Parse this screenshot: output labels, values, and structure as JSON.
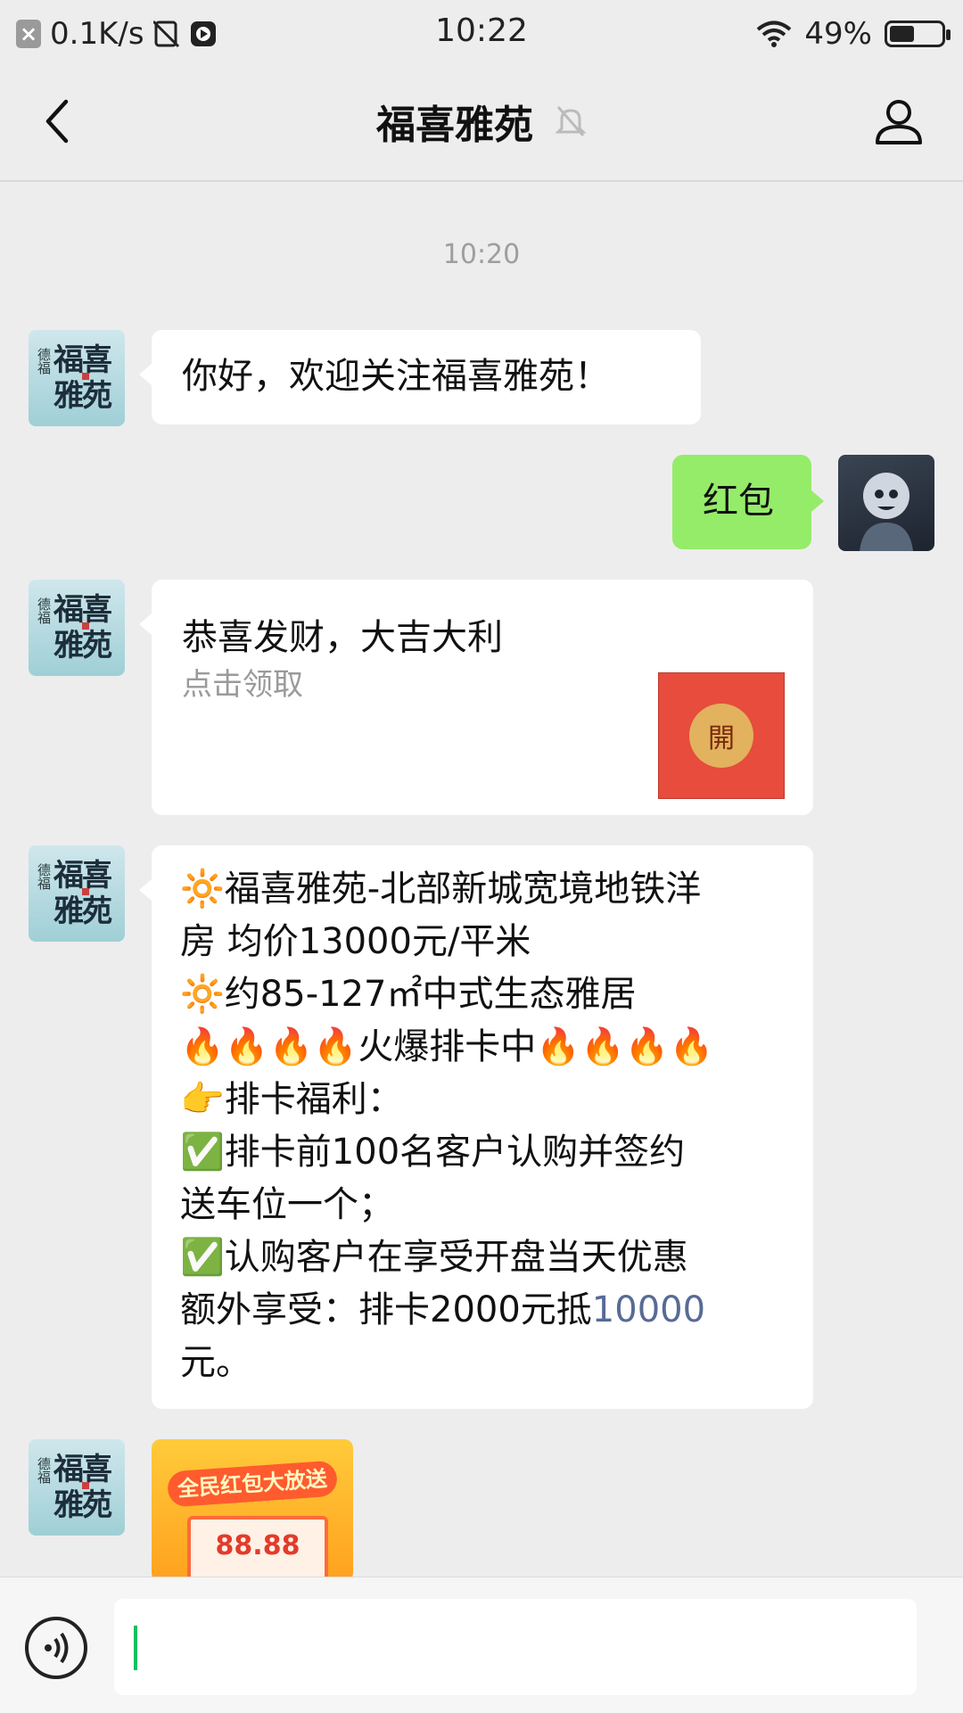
{
  "status_bar": {
    "net_speed": "0.1K/s",
    "time": "10:22",
    "battery": "49%",
    "battery_level": 0.49,
    "icons": [
      "close-app-icon",
      "no-sim-icon",
      "media-play-icon",
      "wifi-icon",
      "battery-icon"
    ]
  },
  "header": {
    "title": "福喜雅苑",
    "icons": [
      "back-arrow-icon",
      "mute-bell-icon",
      "person-icon"
    ]
  },
  "chat": {
    "timestamp": "10:20",
    "avatar_text": {
      "side": "德福",
      "main": "福喜雅苑"
    },
    "messages": [
      {
        "from": "official",
        "text": "你好，欢迎关注福喜雅苑！"
      },
      {
        "from": "me",
        "text": "红包"
      },
      {
        "from": "official",
        "type": "red_packet",
        "title": "恭喜发财，大吉大利",
        "subtitle": "点击领取",
        "button": "開"
      },
      {
        "from": "official",
        "type": "promo",
        "lines": [
          "🔆福喜雅苑-北部新城宽境地铁洋",
          "房 均价13000元/平米",
          "🔆约85-127㎡中式生态雅居",
          "🔥🔥🔥🔥火爆排卡中🔥🔥🔥🔥",
          "👉排卡福利：",
          "✅排卡前100名客户认购并签约",
          "送车位一个；",
          "✅认购客户在享受开盘当天优惠",
          "额外享受：排卡2000元抵",
          "元。"
        ],
        "link_value": "10000"
      },
      {
        "from": "official",
        "type": "image",
        "caption": "全民红包大放送",
        "amount": "88.88"
      }
    ]
  },
  "input": {
    "icons": [
      "voice-icon"
    ],
    "caret_color": "#07c160"
  },
  "colors": {
    "background": "#ededed",
    "my_bubble": "#95ec69",
    "link": "#576b95",
    "envelope": "#e74c3c"
  }
}
